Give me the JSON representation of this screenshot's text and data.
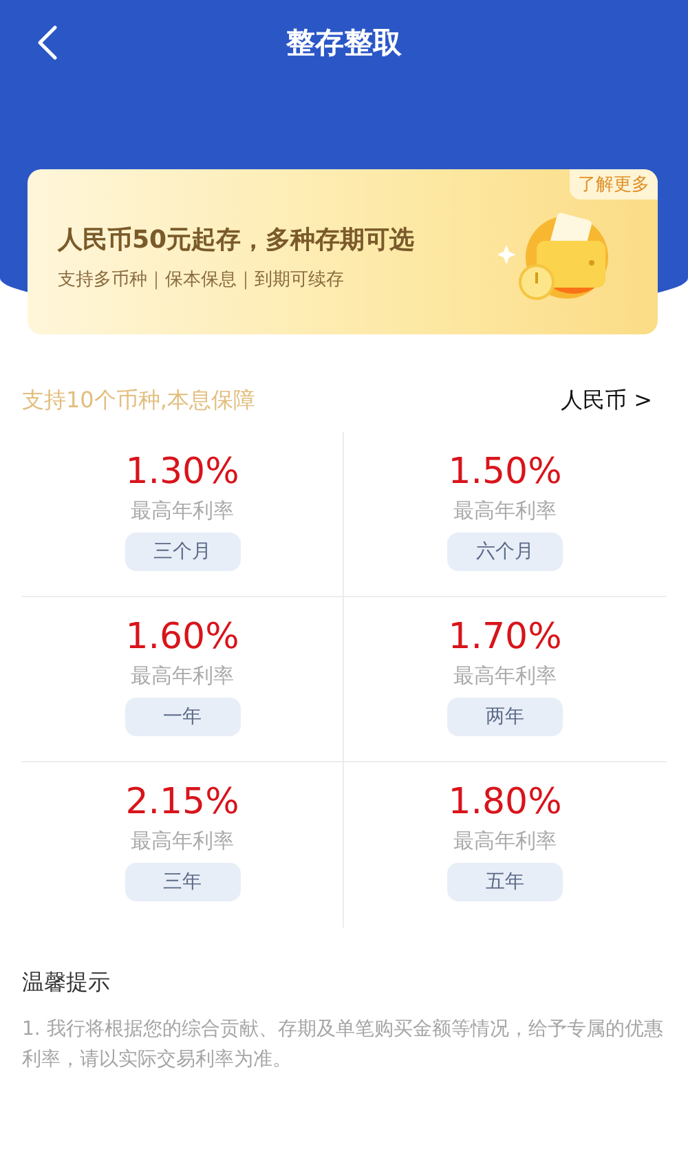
{
  "header": {
    "title": "整存整取"
  },
  "banner": {
    "badge": "了解更多",
    "headline": "人民币50元起存，多种存期可选",
    "subline": "支持多币种｜保本保息｜到期可续存"
  },
  "section": {
    "caption": "支持10个币种,本息保障",
    "currency": "人民币 >"
  },
  "rates": [
    {
      "rate": "1.30%",
      "label": "最高年利率",
      "term": "三个月"
    },
    {
      "rate": "1.50%",
      "label": "最高年利率",
      "term": "六个月"
    },
    {
      "rate": "1.60%",
      "label": "最高年利率",
      "term": "一年"
    },
    {
      "rate": "1.70%",
      "label": "最高年利率",
      "term": "两年"
    },
    {
      "rate": "2.15%",
      "label": "最高年利率",
      "term": "三年"
    },
    {
      "rate": "1.80%",
      "label": "最高年利率",
      "term": "五年"
    }
  ],
  "tips": {
    "title": "温馨提示",
    "text": "1. 我行将根据您的综合贡献、存期及单笔购买金额等情况，给予专属的优惠利率，请以实际交易利率为准。"
  }
}
